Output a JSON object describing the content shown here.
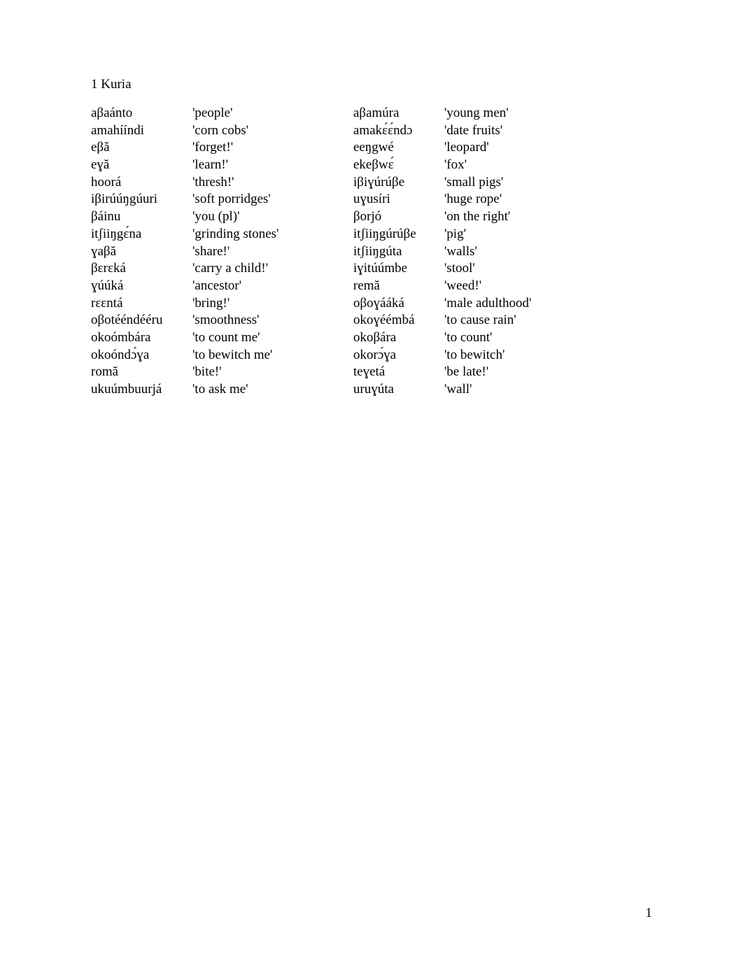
{
  "title": "1 Kuria",
  "pageNumber": "1",
  "left": [
    {
      "word": "aβaánto",
      "gloss": "'people'"
    },
    {
      "word": "amahííndi",
      "gloss": "'corn cobs'"
    },
    {
      "word": "eβă",
      "gloss": "'forget!'"
    },
    {
      "word": "eɣă",
      "gloss": "'learn!'"
    },
    {
      "word": "hoorá",
      "gloss": "'thresh!'"
    },
    {
      "word": "iβirúúŋgúuri",
      "gloss": "'soft porridges'"
    },
    {
      "word": "βáinu",
      "gloss": "'you (pl)'"
    },
    {
      "word": "itʃiiŋgɛ́na",
      "gloss": "'grinding stones'"
    },
    {
      "word": "ɣaβă",
      "gloss": "'share!'"
    },
    {
      "word": "βɛrɛká",
      "gloss": "'carry a child!'"
    },
    {
      "word": "ɣúúká",
      "gloss": "'ancestor'"
    },
    {
      "word": "rɛɛntá",
      "gloss": "'bring!'"
    },
    {
      "word": "oβotééndééru",
      "gloss": "'smoothness'"
    },
    {
      "word": "okoómbára",
      "gloss": "'to count me'"
    },
    {
      "word": "okoóndɔ́ɣa",
      "gloss": "'to bewitch me'"
    },
    {
      "word": "romă",
      "gloss": "'bite!'"
    },
    {
      "word": "ukuúmbuurjá",
      "gloss": "'to ask me'"
    }
  ],
  "right": [
    {
      "word": "aβamúra",
      "gloss": "'young men'"
    },
    {
      "word": "amakɛ́ɛ́ndɔ",
      "gloss": "'date fruits'"
    },
    {
      "word": "eeŋgwé",
      "gloss": "'leopard'"
    },
    {
      "word": "ekeβwɛ́",
      "gloss": "'fox'"
    },
    {
      "word": "iβiɣúrúβe",
      "gloss": "'small pigs'"
    },
    {
      "word": "uɣusíri",
      "gloss": "'huge rope'"
    },
    {
      "word": "βorjó",
      "gloss": "'on the right'"
    },
    {
      "word": "itʃiiŋgúrúβe",
      "gloss": "'pig'"
    },
    {
      "word": "itʃiiŋgúta",
      "gloss": "'walls'"
    },
    {
      "word": "iɣitúúmbe",
      "gloss": "'stool'"
    },
    {
      "word": "remă",
      "gloss": "'weed!'"
    },
    {
      "word": "oβoɣááká",
      "gloss": "'male adulthood'"
    },
    {
      "word": "okoɣéémbá",
      "gloss": "'to cause rain'"
    },
    {
      "word": "okoβára",
      "gloss": "'to count'"
    },
    {
      "word": "okorɔ́ɣa",
      "gloss": "'to bewitch'"
    },
    {
      "word": "teɣetá",
      "gloss": "'be late!'"
    },
    {
      "word": "uruɣúta",
      "gloss": "'wall'"
    }
  ]
}
